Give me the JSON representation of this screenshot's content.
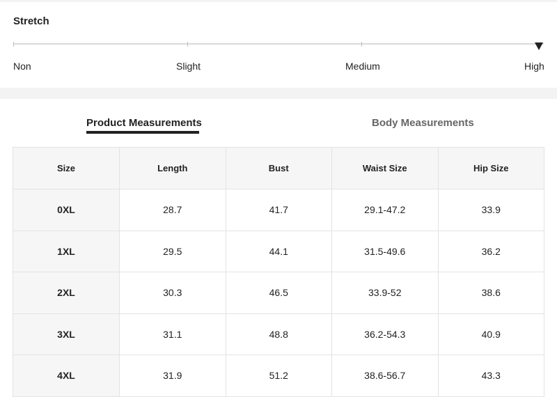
{
  "stretch": {
    "title": "Stretch",
    "levels": [
      "Non",
      "Slight",
      "Medium",
      "High"
    ],
    "selected": "High"
  },
  "tabs": [
    {
      "label": "Product Measurements",
      "active": true
    },
    {
      "label": "Body Measurements",
      "active": false
    }
  ],
  "table": {
    "headers": [
      "Size",
      "Length",
      "Bust",
      "Waist Size",
      "Hip Size"
    ],
    "rows": [
      [
        "0XL",
        "28.7",
        "41.7",
        "29.1-47.2",
        "33.9"
      ],
      [
        "1XL",
        "29.5",
        "44.1",
        "31.5-49.6",
        "36.2"
      ],
      [
        "2XL",
        "30.3",
        "46.5",
        "33.9-52",
        "38.6"
      ],
      [
        "3XL",
        "31.1",
        "48.8",
        "36.2-54.3",
        "40.9"
      ],
      [
        "4XL",
        "31.9",
        "51.2",
        "38.6-56.7",
        "43.3"
      ]
    ]
  },
  "colors": {
    "accent": "#222222",
    "muted": "#666666",
    "band": "#f3f3f3"
  },
  "icons": {
    "selected_marker": "triangle-down-icon"
  }
}
